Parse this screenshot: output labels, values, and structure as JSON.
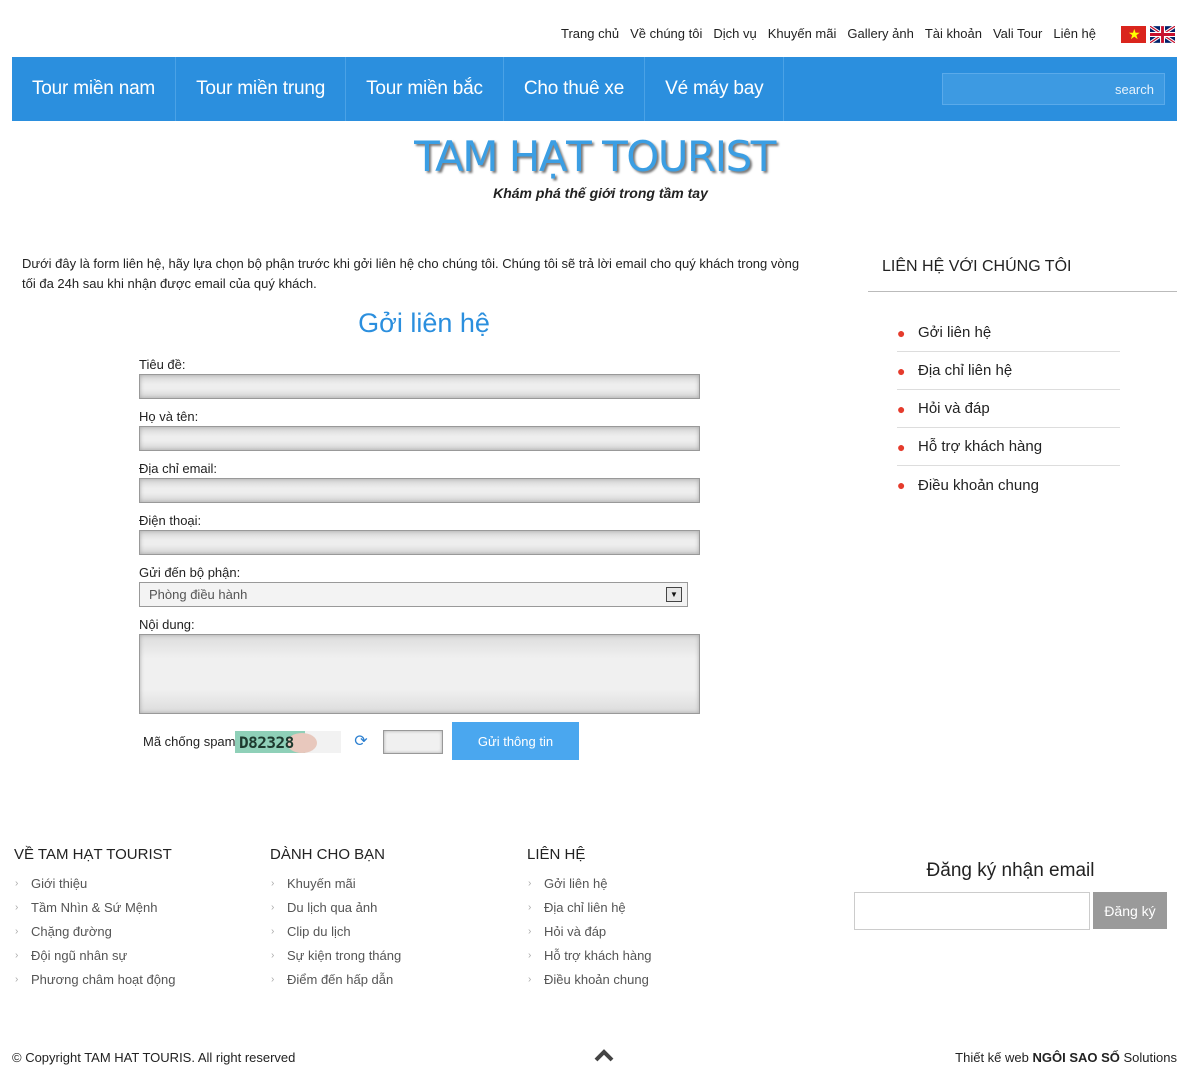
{
  "top_links": [
    "Trang chủ",
    "Về chúng tôi",
    "Dịch vụ",
    "Khuyến mãi",
    "Gallery ảnh",
    "Tài khoản",
    "Vali Tour",
    "Liên hệ"
  ],
  "nav": {
    "items": [
      "Tour miền nam",
      "Tour miền trung",
      "Tour miền bắc",
      "Cho thuê xe",
      "Vé máy bay"
    ],
    "search_label": "search"
  },
  "logo": {
    "title": "TAM HẠT TOURIST",
    "subtitle": "Khám phá thế giới trong tầm tay"
  },
  "intro": "Dưới đây là form liên hệ, hãy lựa chọn bộ phận trước khi gởi liên hệ cho chúng tôi. Chúng tôi sẽ trả lời email cho quý khách trong vòng tối đa 24h sau khi nhận được email của quý khách.",
  "form": {
    "title": "Gởi liên hệ",
    "subject_label": "Tiêu đề:",
    "name_label": "Họ và tên:",
    "email_label": "Địa chỉ email:",
    "phone_label": "Điện thoại:",
    "department_label": "Gửi đến bộ phận:",
    "department_value": "Phòng điều hành",
    "content_label": "Nội dung:",
    "spam_label": "Mã chống spam:",
    "captcha_text": "D82328",
    "submit_label": "Gửi thông tin"
  },
  "sidebar": {
    "title": "LIÊN HỆ VỚI CHÚNG TÔI",
    "items": [
      "Gởi liên hệ",
      "Địa chỉ liên hệ",
      "Hỏi và đáp",
      "Hỗ trợ khách hàng",
      "Điều khoản chung"
    ]
  },
  "footer": {
    "columns": [
      {
        "title": "VỀ TAM HẠT TOURIST",
        "items": [
          "Giới thiệu",
          "Tầm Nhìn & Sứ Mệnh",
          "Chặng đường",
          "Đội ngũ nhân sự",
          "Phương châm hoạt động"
        ]
      },
      {
        "title": "DÀNH CHO BẠN",
        "items": [
          "Khuyến mãi",
          "Du lịch qua ảnh",
          "Clip du lịch",
          "Sự kiện trong tháng",
          "Điểm đến hấp dẫn"
        ]
      },
      {
        "title": "LIÊN HỆ",
        "items": [
          "Gởi liên hệ",
          "Địa chỉ liên hệ",
          "Hỏi và đáp",
          "Hỗ trợ khách hàng",
          "Điều khoản chung"
        ]
      }
    ],
    "newsletter_title": "Đăng ký nhận email",
    "newsletter_button": "Đăng ký",
    "copyright": "© Copyright TAM HAT TOURIS. All right reserved",
    "credit_prefix": "Thiết kế web",
    "credit_brand": "NGÔI SAO SỐ",
    "credit_suffix": "Solutions"
  },
  "colors": {
    "nav_bg": "#2b8fde",
    "accent": "#2b8fde",
    "bullet": "#e53b2c",
    "submit": "#4aa7ef"
  }
}
